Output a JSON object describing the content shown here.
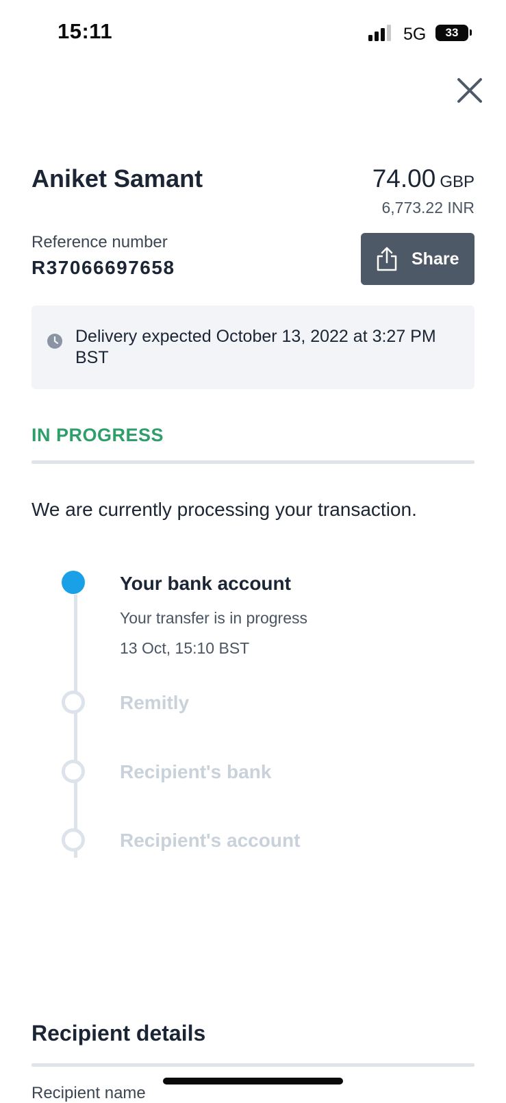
{
  "status_bar": {
    "time": "15:11",
    "network": "5G",
    "battery": "33"
  },
  "transfer": {
    "recipient_name": "Aniket Samant",
    "amount": "74.00",
    "currency": "GBP",
    "converted_amount": "6,773.22 INR",
    "reference_label": "Reference number",
    "reference_number": "R37066697658",
    "share_label": "Share"
  },
  "delivery": {
    "text": "Delivery expected October 13, 2022 at 3:27 PM BST"
  },
  "status": {
    "label": "IN PROGRESS",
    "label_color": "#2e9f6b",
    "message": "We are currently processing your transaction."
  },
  "timeline": {
    "steps": [
      {
        "title": "Your bank account",
        "state": "active",
        "subtitle": "Your transfer is in progress",
        "timestamp": "13 Oct, 15:10 BST"
      },
      {
        "title": "Remitly",
        "state": "pending"
      },
      {
        "title": "Recipient's bank",
        "state": "pending"
      },
      {
        "title": "Recipient's account",
        "state": "pending"
      }
    ],
    "active_color": "#1aa0e6"
  },
  "recipient_details": {
    "title": "Recipient details",
    "name_label": "Recipient name"
  },
  "icons": {
    "close": "close-icon",
    "share": "share-icon",
    "clock": "clock-icon"
  }
}
